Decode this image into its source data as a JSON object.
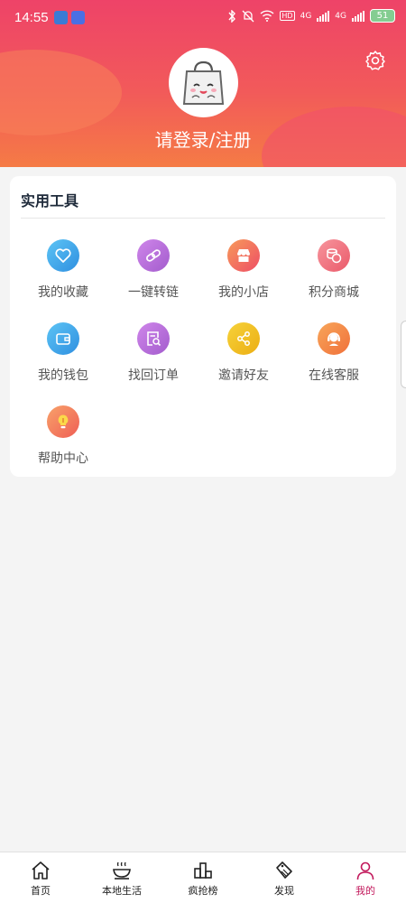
{
  "status_bar": {
    "time": "14:55",
    "battery": "51",
    "net1": "4G",
    "net2": "4G",
    "hd": "HD"
  },
  "profile": {
    "login_label": "请登录/注册"
  },
  "tools": {
    "title": "实用工具",
    "items": [
      {
        "label": "我的收藏",
        "icon": "heart-icon",
        "color": "#36a2e6"
      },
      {
        "label": "一键转链",
        "icon": "link-icon",
        "color": "#b56bd6"
      },
      {
        "label": "我的小店",
        "icon": "shop-icon",
        "color": "#f0665b"
      },
      {
        "label": "积分商城",
        "icon": "coins-icon",
        "color": "#f0707a"
      },
      {
        "label": "我的钱包",
        "icon": "wallet-icon",
        "color": "#36a2e6"
      },
      {
        "label": "找回订单",
        "icon": "order-search-icon",
        "color": "#b56bd6"
      },
      {
        "label": "邀请好友",
        "icon": "share-icon",
        "color": "#f0b41e"
      },
      {
        "label": "在线客服",
        "icon": "customer-service-icon",
        "color": "#f48a3c"
      },
      {
        "label": "帮助中心",
        "icon": "lightbulb-icon",
        "color": "#f07a5a"
      }
    ]
  },
  "tabbar": {
    "items": [
      {
        "label": "首页",
        "icon": "home-icon"
      },
      {
        "label": "本地生活",
        "icon": "coffee-cup-icon"
      },
      {
        "label": "疯抢榜",
        "icon": "ranking-icon"
      },
      {
        "label": "发现",
        "icon": "tag-icon"
      },
      {
        "label": "我的",
        "icon": "user-icon",
        "active": true
      }
    ]
  },
  "colors": {
    "accent": "#c2185b",
    "header_top": "#ee4368",
    "header_bottom": "#f57b45"
  }
}
